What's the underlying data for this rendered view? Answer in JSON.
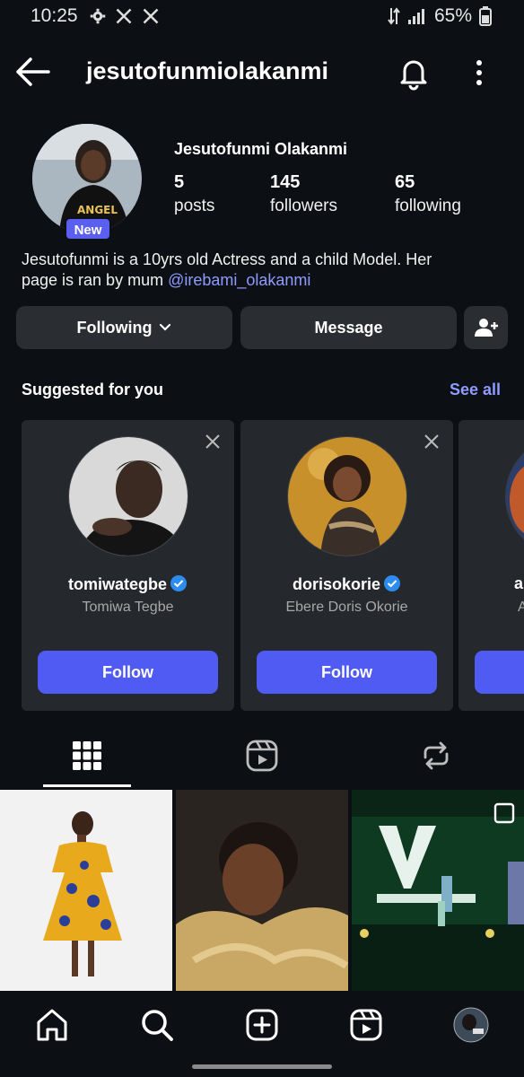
{
  "status_bar": {
    "time": "10:25",
    "battery": "65%"
  },
  "header": {
    "username": "jesutofunmiolakanmi"
  },
  "profile": {
    "new_badge": "New",
    "full_name": "Jesutofunmi Olakanmi",
    "stats": [
      {
        "num": "5",
        "label": "posts"
      },
      {
        "num": "145",
        "label": "followers"
      },
      {
        "num": "65",
        "label": "following"
      }
    ],
    "bio_line1": "Jesutofunmi is a 10yrs old Actress and a child Model. Her",
    "bio_line2_prefix": "page is ran by mum ",
    "bio_mention": "@irebami_olakanmi"
  },
  "actions": {
    "following": "Following",
    "message": "Message"
  },
  "suggested": {
    "title": "Suggested for you",
    "see_all": "See all",
    "cards": [
      {
        "username": "tomiwategbe",
        "name": "Tomiwa Tegbe",
        "button": "Follow"
      },
      {
        "username": "dorisokorie",
        "name": "Ebere Doris Okorie",
        "button": "Follow"
      },
      {
        "username": "a",
        "name": "A",
        "button": ""
      }
    ]
  },
  "colors": {
    "accent": "#4f5bf3",
    "link": "#8f9bff",
    "verified": "#2d8cf0"
  }
}
